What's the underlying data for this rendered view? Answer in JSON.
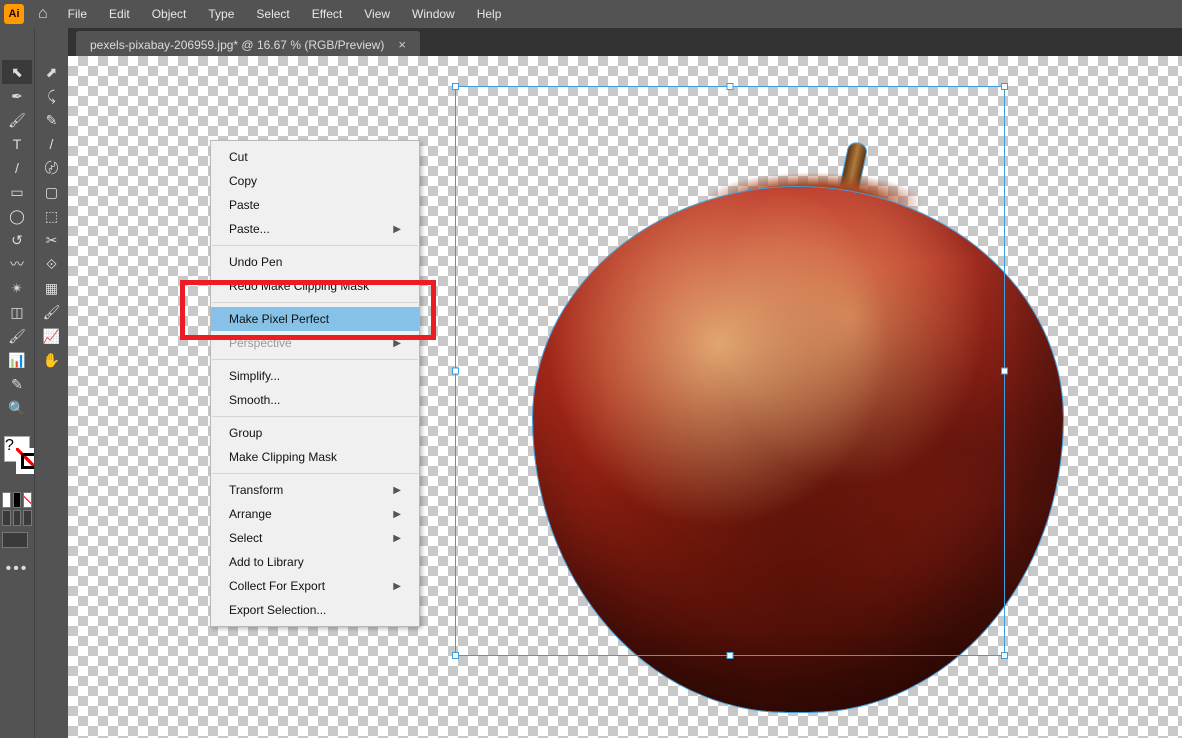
{
  "app": {
    "logo": "Ai"
  },
  "menu": [
    "File",
    "Edit",
    "Object",
    "Type",
    "Select",
    "Effect",
    "View",
    "Window",
    "Help"
  ],
  "tab": {
    "label": "pexels-pixabay-206959.jpg* @ 16.67 % (RGB/Preview)"
  },
  "context_menu": {
    "group1": [
      {
        "label": "Cut"
      },
      {
        "label": "Copy"
      },
      {
        "label": "Paste"
      },
      {
        "label": "Paste...",
        "submenu": true
      }
    ],
    "group2": [
      {
        "label": "Undo Pen"
      },
      {
        "label": "Redo Make Clipping Mask"
      }
    ],
    "group3": [
      {
        "label": "Make Pixel Perfect",
        "highlighted": true
      },
      {
        "label": "Perspective",
        "submenu": true,
        "disabled": true
      }
    ],
    "group4": [
      {
        "label": "Simplify..."
      },
      {
        "label": "Smooth..."
      }
    ],
    "group5": [
      {
        "label": "Group"
      },
      {
        "label": "Make Clipping Mask"
      }
    ],
    "group6": [
      {
        "label": "Transform",
        "submenu": true
      },
      {
        "label": "Arrange",
        "submenu": true
      },
      {
        "label": "Select",
        "submenu": true
      },
      {
        "label": "Add to Library"
      },
      {
        "label": "Collect For Export",
        "submenu": true
      },
      {
        "label": "Export Selection..."
      }
    ]
  },
  "tools_left": [
    "⬉",
    "✒",
    "🖌",
    "T",
    "/",
    "▭",
    "◯",
    "↺",
    "〰",
    "✴",
    "◫",
    "🖌",
    "📊",
    "✎",
    "🔍"
  ],
  "tools_right": [
    "⬈",
    "⤹",
    "✎",
    "/",
    "〄",
    "▢",
    "⬚",
    "✂",
    "⟐",
    "▦",
    "🖌",
    "📈",
    "✋"
  ]
}
